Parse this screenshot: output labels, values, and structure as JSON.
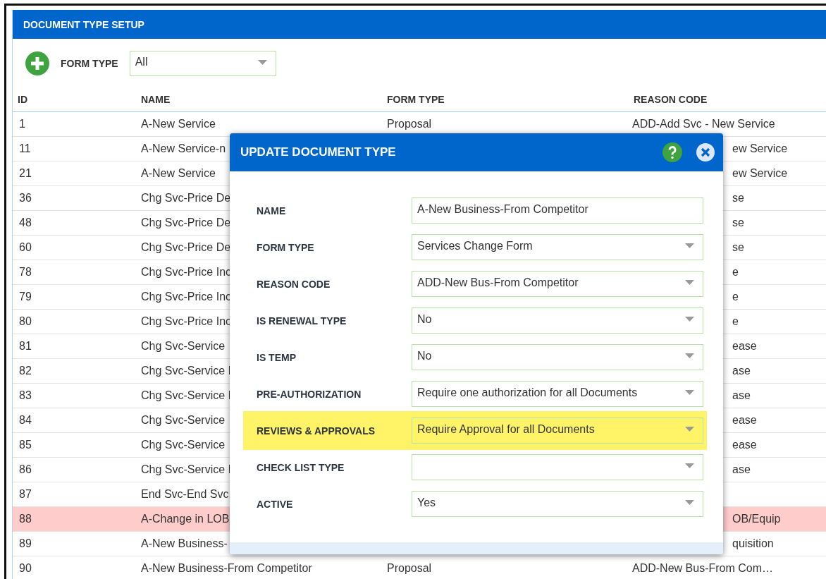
{
  "panel": {
    "title": "DOCUMENT TYPE SETUP"
  },
  "filter": {
    "label": "FORM TYPE",
    "value": "All"
  },
  "table": {
    "columns": [
      "ID",
      "NAME",
      "FORM TYPE",
      "REASON CODE"
    ],
    "rows": [
      {
        "id": "1",
        "name": "A-New Service",
        "form_type": "Proposal",
        "reason_code": "ADD-Add Svc - New Service",
        "selected": false
      },
      {
        "id": "11",
        "name": "A-New Service-n",
        "reason_code": "ew Service",
        "selected": false
      },
      {
        "id": "21",
        "name": "A-New Service",
        "reason_code": "ew Service",
        "selected": false
      },
      {
        "id": "36",
        "name": "Chg Svc-Price De",
        "reason_code": "se",
        "selected": false
      },
      {
        "id": "48",
        "name": "Chg Svc-Price De",
        "reason_code": "se",
        "selected": false
      },
      {
        "id": "60",
        "name": "Chg Svc-Price De",
        "reason_code": "se",
        "selected": false
      },
      {
        "id": "78",
        "name": "Chg Svc-Price Inc",
        "reason_code": "e",
        "selected": false
      },
      {
        "id": "79",
        "name": "Chg Svc-Price Inc",
        "reason_code": "e",
        "selected": false
      },
      {
        "id": "80",
        "name": "Chg Svc-Price Inc",
        "reason_code": "e",
        "selected": false
      },
      {
        "id": "81",
        "name": "Chg Svc-Service",
        "reason_code": "ease",
        "selected": false
      },
      {
        "id": "82",
        "name": "Chg Svc-Service I",
        "reason_code": "ase",
        "selected": false
      },
      {
        "id": "83",
        "name": "Chg Svc-Service I",
        "reason_code": "ase",
        "selected": false
      },
      {
        "id": "84",
        "name": "Chg Svc-Service",
        "reason_code": "ease",
        "selected": false
      },
      {
        "id": "85",
        "name": "Chg Svc-Service",
        "reason_code": "ease",
        "selected": false
      },
      {
        "id": "86",
        "name": "Chg Svc-Service I",
        "reason_code": "ase",
        "selected": false
      },
      {
        "id": "87",
        "name": "End Svc-End Svc",
        "selected": false
      },
      {
        "id": "88",
        "name": "A-Change in LOB",
        "reason_code": "OB/Equip",
        "selected": true
      },
      {
        "id": "89",
        "name": "A-New Business-",
        "reason_code": "quisition",
        "selected": false
      },
      {
        "id": "90",
        "name": "A-New Business-From Competitor",
        "form_type": "Proposal",
        "reason_code": "ADD-New Bus-From Com…",
        "selected": false
      }
    ]
  },
  "dialog": {
    "title": "UPDATE DOCUMENT TYPE",
    "fields": [
      {
        "label": "NAME",
        "kind": "text",
        "value": "A-New Business-From Competitor",
        "highlighted": false
      },
      {
        "label": "FORM TYPE",
        "kind": "select",
        "value": "Services Change Form",
        "highlighted": false
      },
      {
        "label": "REASON CODE",
        "kind": "select",
        "value": "ADD-New Bus-From Competitor",
        "highlighted": false
      },
      {
        "label": "IS RENEWAL TYPE",
        "kind": "select",
        "value": "No",
        "highlighted": false
      },
      {
        "label": "IS TEMP",
        "kind": "select",
        "value": "No",
        "highlighted": false
      },
      {
        "label": "PRE-AUTHORIZATION",
        "kind": "select",
        "value": "Require one authorization for all Documents",
        "highlighted": false
      },
      {
        "label": "REVIEWS & APPROVALS",
        "kind": "select",
        "value": "Require Approval for all Documents",
        "highlighted": true
      },
      {
        "label": "CHECK LIST TYPE",
        "kind": "select",
        "highlighted": false
      },
      {
        "label": "ACTIVE",
        "kind": "select",
        "value": "Yes",
        "highlighted": false
      }
    ]
  }
}
